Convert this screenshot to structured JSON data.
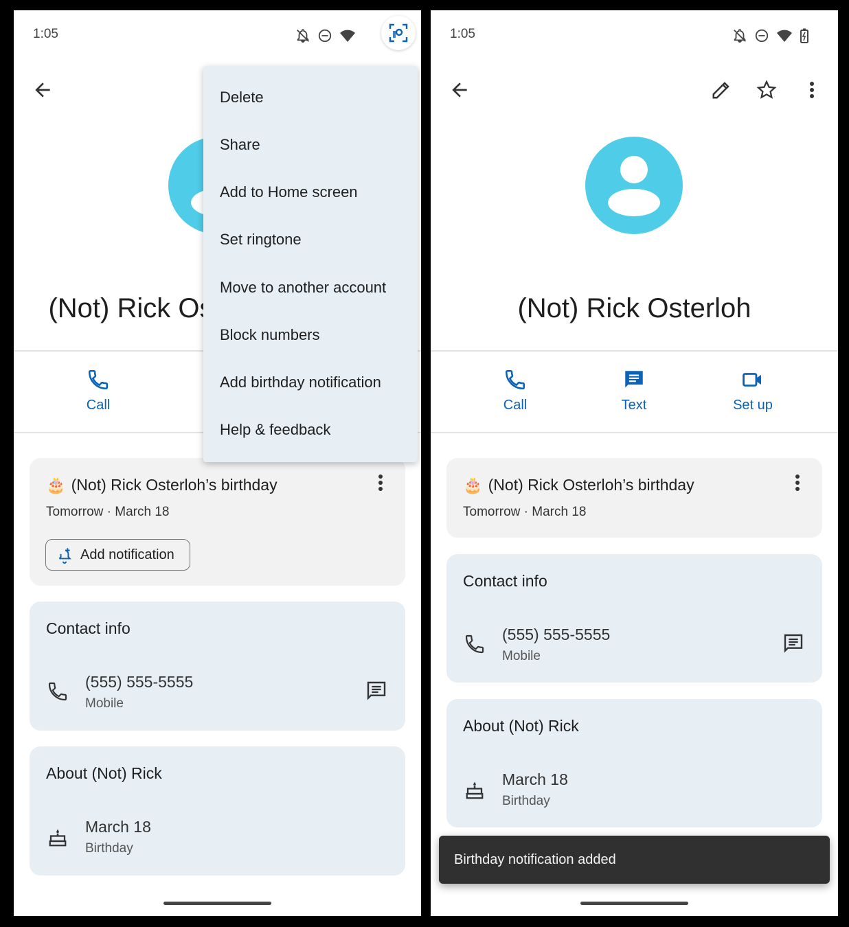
{
  "left_screen": {
    "status": {
      "time": "1:05"
    },
    "contact_name": "(Not) Rick Osterloh",
    "actions": {
      "call": "Call"
    },
    "menu": {
      "items": [
        "Delete",
        "Share",
        "Add to Home screen",
        "Set ringtone",
        "Move to another account",
        "Block numbers",
        "Add birthday notification",
        "Help & feedback"
      ]
    },
    "birthday_card": {
      "emoji": "🎂",
      "title": "(Not) Rick Osterloh’s birthday",
      "subtitle": "Tomorrow · March 18",
      "button_label": "Add notification"
    },
    "contact_info": {
      "heading": "Contact info",
      "phone": "(555) 555-5555",
      "phone_type": "Mobile"
    },
    "about": {
      "heading": "About (Not) Rick",
      "date": "March 18",
      "date_type": "Birthday"
    }
  },
  "right_screen": {
    "status": {
      "time": "1:05"
    },
    "contact_name": "(Not) Rick Osterloh",
    "actions": {
      "call": "Call",
      "text": "Text",
      "setup": "Set up"
    },
    "birthday_card": {
      "emoji": "🎂",
      "title": "(Not) Rick Osterloh’s birthday",
      "subtitle": "Tomorrow · March 18"
    },
    "contact_info": {
      "heading": "Contact info",
      "phone": "(555) 555-5555",
      "phone_type": "Mobile"
    },
    "about": {
      "heading": "About (Not) Rick",
      "date": "March 18",
      "date_type": "Birthday"
    },
    "snackbar": "Birthday notification added"
  },
  "colors": {
    "accent": "#0b63b6",
    "avatar": "#4fcce8",
    "card_blue": "#e7eef4",
    "card_gray": "#f2f2f2",
    "snackbar": "#303030"
  },
  "icons": {
    "status": [
      "bell-off-icon",
      "do-not-disturb-icon",
      "wifi-icon",
      "battery-icon",
      "screen-lens-icon"
    ],
    "toolbar": [
      "back-arrow-icon",
      "edit-pencil-icon",
      "star-icon",
      "more-vert-icon"
    ],
    "actions": [
      "phone-icon",
      "message-icon",
      "video-icon"
    ],
    "rows": [
      "phone-icon",
      "message-icon",
      "cake-icon",
      "add-alert-icon"
    ]
  }
}
